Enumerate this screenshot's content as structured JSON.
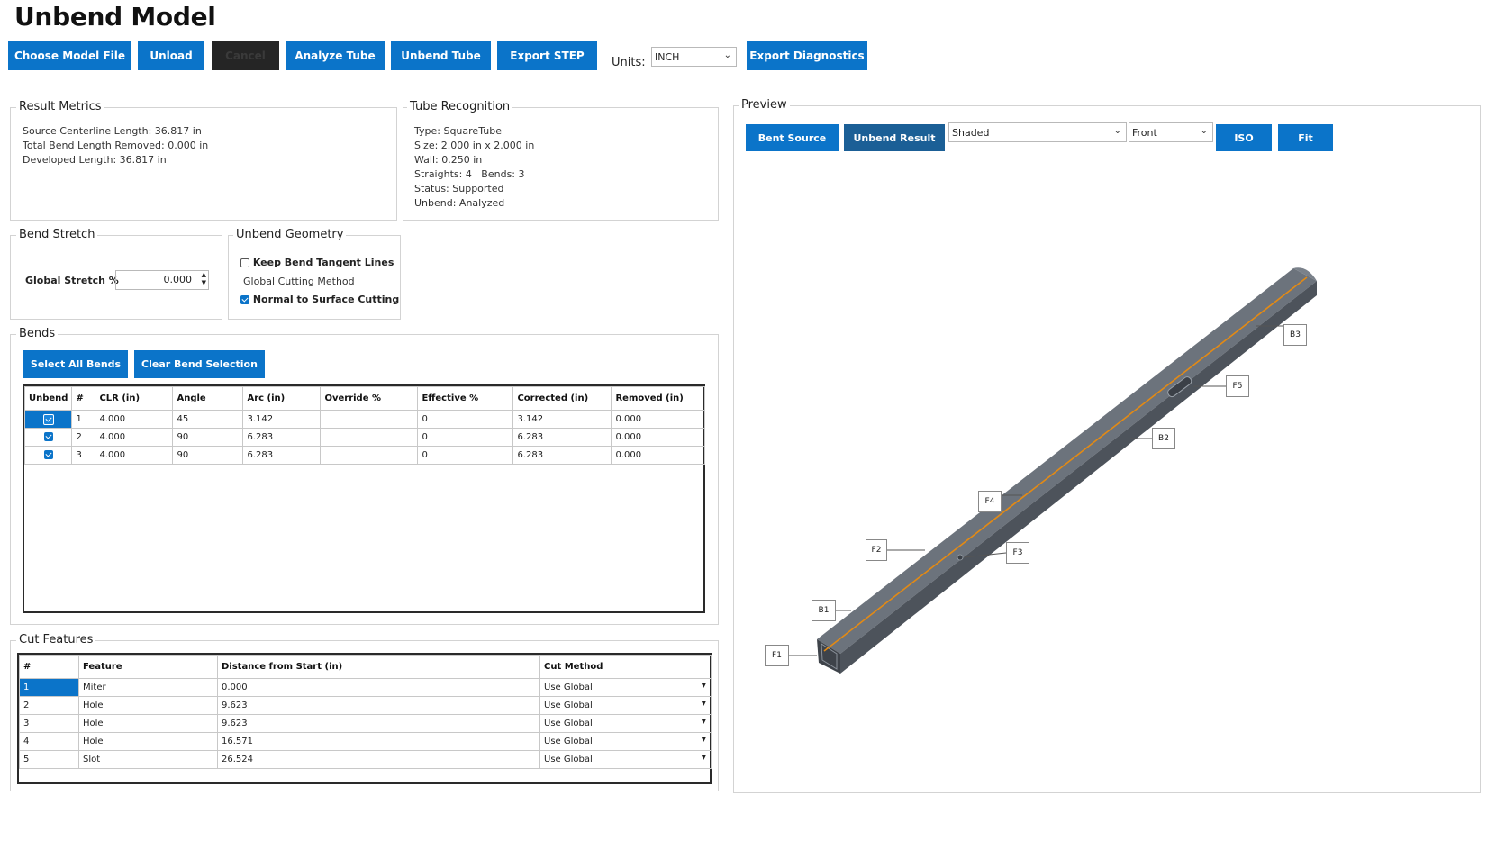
{
  "title": "Unbend Model",
  "toolbar": {
    "choose": "Choose Model File",
    "unload": "Unload",
    "cancel": "Cancel",
    "analyze": "Analyze Tube",
    "unbend": "Unbend Tube",
    "export_step": "Export STEP",
    "units_label": "Units:",
    "units_value": "INCH",
    "export_diag": "Export Diagnostics"
  },
  "metrics": {
    "title": "Result Metrics",
    "lines": [
      "Source Centerline Length: 36.817 in",
      "Total Bend Length Removed: 0.000 in",
      "Developed Length: 36.817 in"
    ]
  },
  "recognition": {
    "title": "Tube Recognition",
    "lines": [
      "Type: SquareTube",
      "Size: 2.000 in x 2.000 in",
      "Wall: 0.250 in",
      "Straights: 4   Bends: 3",
      "Status: Supported",
      "Unbend: Analyzed"
    ]
  },
  "stretch": {
    "title": "Bend Stretch",
    "label": "Global Stretch %",
    "value": "0.000"
  },
  "geometry": {
    "title": "Unbend Geometry",
    "keep_tangent": "Keep Bend Tangent Lines",
    "cut_method_label": "Global Cutting Method",
    "normal_cut": "Normal to Surface Cutting"
  },
  "bends": {
    "title": "Bends",
    "select_all": "Select All Bends",
    "clear": "Clear Bend Selection",
    "columns": [
      "Unbend",
      "#",
      "CLR (in)",
      "Angle",
      "Arc (in)",
      "Override %",
      "Effective %",
      "Corrected (in)",
      "Removed (in)"
    ],
    "rows": [
      [
        "1",
        "4.000",
        "45",
        "3.142",
        "",
        "0",
        "3.142",
        "0.000"
      ],
      [
        "2",
        "4.000",
        "90",
        "6.283",
        "",
        "0",
        "6.283",
        "0.000"
      ],
      [
        "3",
        "4.000",
        "90",
        "6.283",
        "",
        "0",
        "6.283",
        "0.000"
      ]
    ]
  },
  "cuts": {
    "title": "Cut Features",
    "columns": [
      "#",
      "Feature",
      "Distance from Start (in)",
      "Cut Method"
    ],
    "rows": [
      [
        "1",
        "Miter",
        "0.000",
        "Use Global"
      ],
      [
        "2",
        "Hole",
        "9.623",
        "Use Global"
      ],
      [
        "3",
        "Hole",
        "9.623",
        "Use Global"
      ],
      [
        "4",
        "Hole",
        "16.571",
        "Use Global"
      ],
      [
        "5",
        "Slot",
        "26.524",
        "Use Global"
      ]
    ]
  },
  "preview": {
    "title": "Preview",
    "bent_source": "Bent Source",
    "unbend_result": "Unbend Result",
    "render_mode": "Shaded",
    "view": "Front",
    "iso": "ISO",
    "fit": "Fit",
    "callouts": [
      "B3",
      "F5",
      "B2",
      "F4",
      "F2",
      "F3",
      "B1",
      "F1"
    ]
  },
  "colors": {
    "accent": "#0b74c9",
    "tube": "#5f6670",
    "centerline": "#e38a14"
  }
}
